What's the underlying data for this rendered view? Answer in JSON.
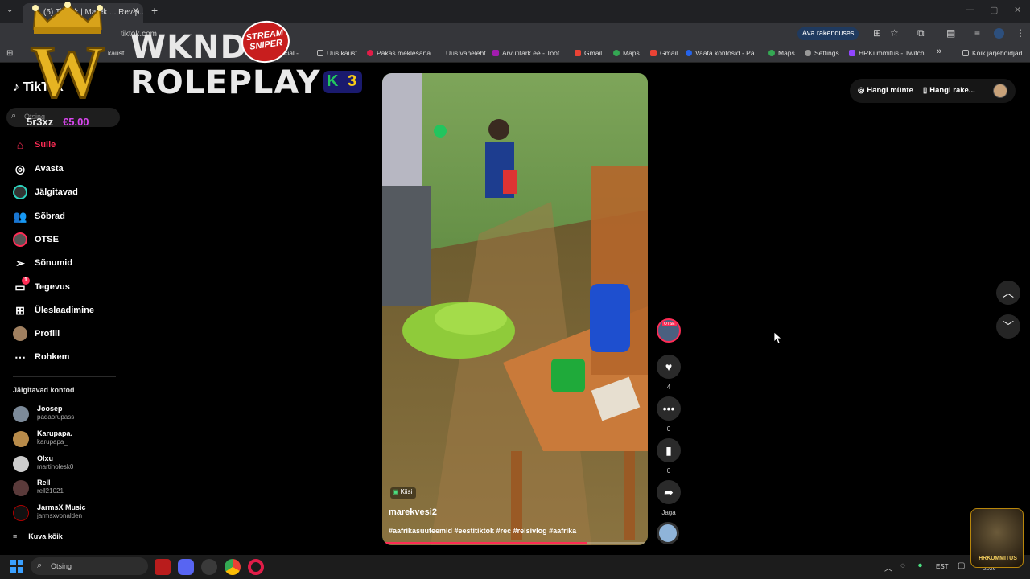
{
  "browser": {
    "tab_title": "(5) TikTok | Marek ... Rev p...",
    "url": "tiktok.com",
    "open_in_app": "Ava rakenduses",
    "bookmarks": [
      "kaust",
      "Official -...",
      "Uus kaust",
      "Pakas meklēšana",
      "Uus vaheleht",
      "Arvutitark.ee - Toot...",
      "Gmail",
      "Maps",
      "Gmail",
      "Vaata kontosid - Pa...",
      "Maps",
      "Settings",
      "HRKummitus - Twitch"
    ],
    "all_bookmarks": "Kõik järjehoidjad",
    "more": "»"
  },
  "overlay": {
    "brand_top": "WKND",
    "brand_bottom": "ROLEPLAY",
    "badge": "3",
    "sniper_line1": "STREAM",
    "sniper_line2": "SNIPER",
    "user_tag": "5r3xz",
    "balance": "€5.00",
    "logo_letter": "W"
  },
  "tiktok": {
    "logo_text": "TikTok",
    "search_placeholder": "Otsing",
    "nav": [
      {
        "label": "Sulle",
        "icon": "home-icon",
        "active": true
      },
      {
        "label": "Avasta",
        "icon": "compass-icon",
        "active": false
      },
      {
        "label": "Jälgitavad",
        "icon": "following-icon",
        "active": false
      },
      {
        "label": "Sõbrad",
        "icon": "friends-icon",
        "active": false
      },
      {
        "label": "OTSE",
        "icon": "live-icon",
        "active": false
      },
      {
        "label": "Sõnumid",
        "icon": "messages-icon",
        "active": false
      },
      {
        "label": "Tegevus",
        "icon": "activity-icon",
        "active": false
      },
      {
        "label": "Üleslaadimine",
        "icon": "upload-icon",
        "active": false
      },
      {
        "label": "Profiil",
        "icon": "profile-icon",
        "active": false
      },
      {
        "label": "Rohkem",
        "icon": "more-icon",
        "active": false
      }
    ],
    "activity_badge": "1",
    "following_title": "Jälgitavad kontod",
    "following": [
      {
        "name": "Joosep",
        "handle": "padaorupass"
      },
      {
        "name": "Karupapa.",
        "handle": "karupapa_"
      },
      {
        "name": "Olxu",
        "handle": "martinolesk0"
      },
      {
        "name": "Rell",
        "handle": "rell21021"
      },
      {
        "name": "JarmsX Music",
        "handle": "jarmsxvonalden"
      }
    ],
    "see_all": "Kuva kõik",
    "top_right": {
      "coins": "Hangi münte",
      "app": "Hangi rake..."
    },
    "video": {
      "label": "Kiisi",
      "author": "marekvesi2",
      "caption": "#aafrikasuuteemid #eestitiktok #rec #reisivlog #aafrika",
      "progress": 0.77
    },
    "actions": {
      "live_badge": "OTSE",
      "likes": "4",
      "comments": "0",
      "saves": "0",
      "share": "Jaga"
    }
  },
  "taskbar": {
    "search": "Otsing",
    "lang": "EST",
    "streamer": "HRKUMMITUS",
    "date_fragment": "2026"
  },
  "colors": {
    "accent": "#fe2c55",
    "badge_green": "#22c55e",
    "balance": "#d946ef"
  }
}
